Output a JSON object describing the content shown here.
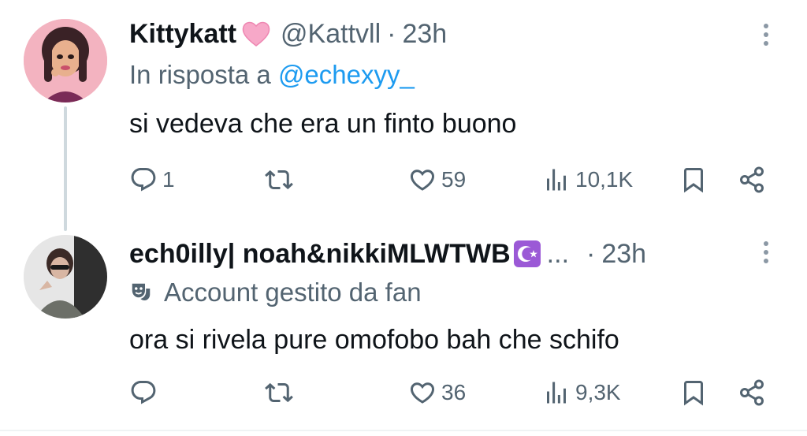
{
  "tweets": [
    {
      "display_name": "Kittykatt",
      "handle": "@Kattvll",
      "separator": "·",
      "time": "23h",
      "reply_prefix": "In risposta a",
      "reply_to": "@echexyy_",
      "text": "si vedeva che era un finto buono",
      "stats": {
        "replies": "1",
        "retweets": "",
        "likes": "59",
        "views": "10,1K"
      }
    },
    {
      "display_name": "ech0illy| noah&nikkiMLWTWB",
      "ellipsis": "...",
      "separator": "·",
      "time": "23h",
      "account_label": "Account gestito da fan",
      "text": "ora si rivela pure omofobo bah che schifo",
      "stats": {
        "replies": "",
        "retweets": "",
        "likes": "36",
        "views": "9,3K"
      }
    }
  ],
  "colors": {
    "text": "#0f1419",
    "muted": "#536471",
    "link": "#1d9bf0",
    "icon": "#536471",
    "thread_line": "#cfd9de"
  },
  "icons": {
    "reply": "reply-icon",
    "retweet": "retweet-icon",
    "like": "heart-outline-icon",
    "views": "bar-chart-icon",
    "bookmark": "bookmark-icon",
    "share": "share-icon",
    "more": "more-dots-icon",
    "fan_account": "theater-masks-icon"
  }
}
